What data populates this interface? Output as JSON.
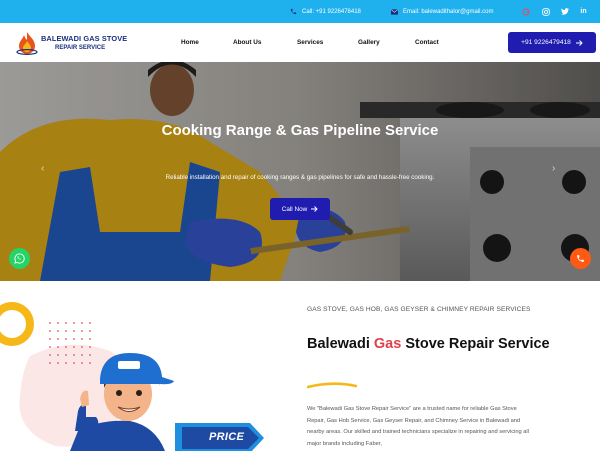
{
  "topbar": {
    "call_text": "Call: +91 9226478418",
    "email_text": "Email: balewadithalor@gmail.com",
    "social_icons": [
      "google-icon",
      "instagram-icon",
      "twitter-icon",
      "linkedin-icon"
    ]
  },
  "header": {
    "logo_line1": "BALEWADI GAS STOVE",
    "logo_line2": "REPAIR SERVICE",
    "nav": [
      "Home",
      "About Us",
      "Services",
      "Gallery",
      "Contact"
    ],
    "cta_phone": "+91 9226479418"
  },
  "hero": {
    "title": "Cooking Range & Gas Pipeline Service",
    "subtitle": "Reliable installation and repair of cooking ranges & gas pipelines for safe and hassle-free cooking.",
    "button_label": "Call Now"
  },
  "about": {
    "eyebrow": "GAS STOVE, GAS HOB, GAS GEYSER & CHIMNEY REPAIR SERVICES",
    "heading_pre": "Balewadi ",
    "heading_accent": "Gas",
    "heading_post": " Stove Repair Service",
    "paragraph": "We \"Balewadi Gas Stove Repair Service\" are a trusted name for reliable Gas Stove Repair, Gas Hob Service, Gas Geyser Repair, and Chimney Service in Balewadi and nearby areas. Our skilled and trained technicians specialize in repairing and servicing all major brands including Faber,",
    "price_tag": "PRICE"
  },
  "colors": {
    "topbar": "#1fb0ee",
    "primary": "#1f1caf",
    "accent": "#e33f4a",
    "whatsapp": "#25d366",
    "phone_float": "#ff5a14",
    "ring": "#f6b719"
  }
}
